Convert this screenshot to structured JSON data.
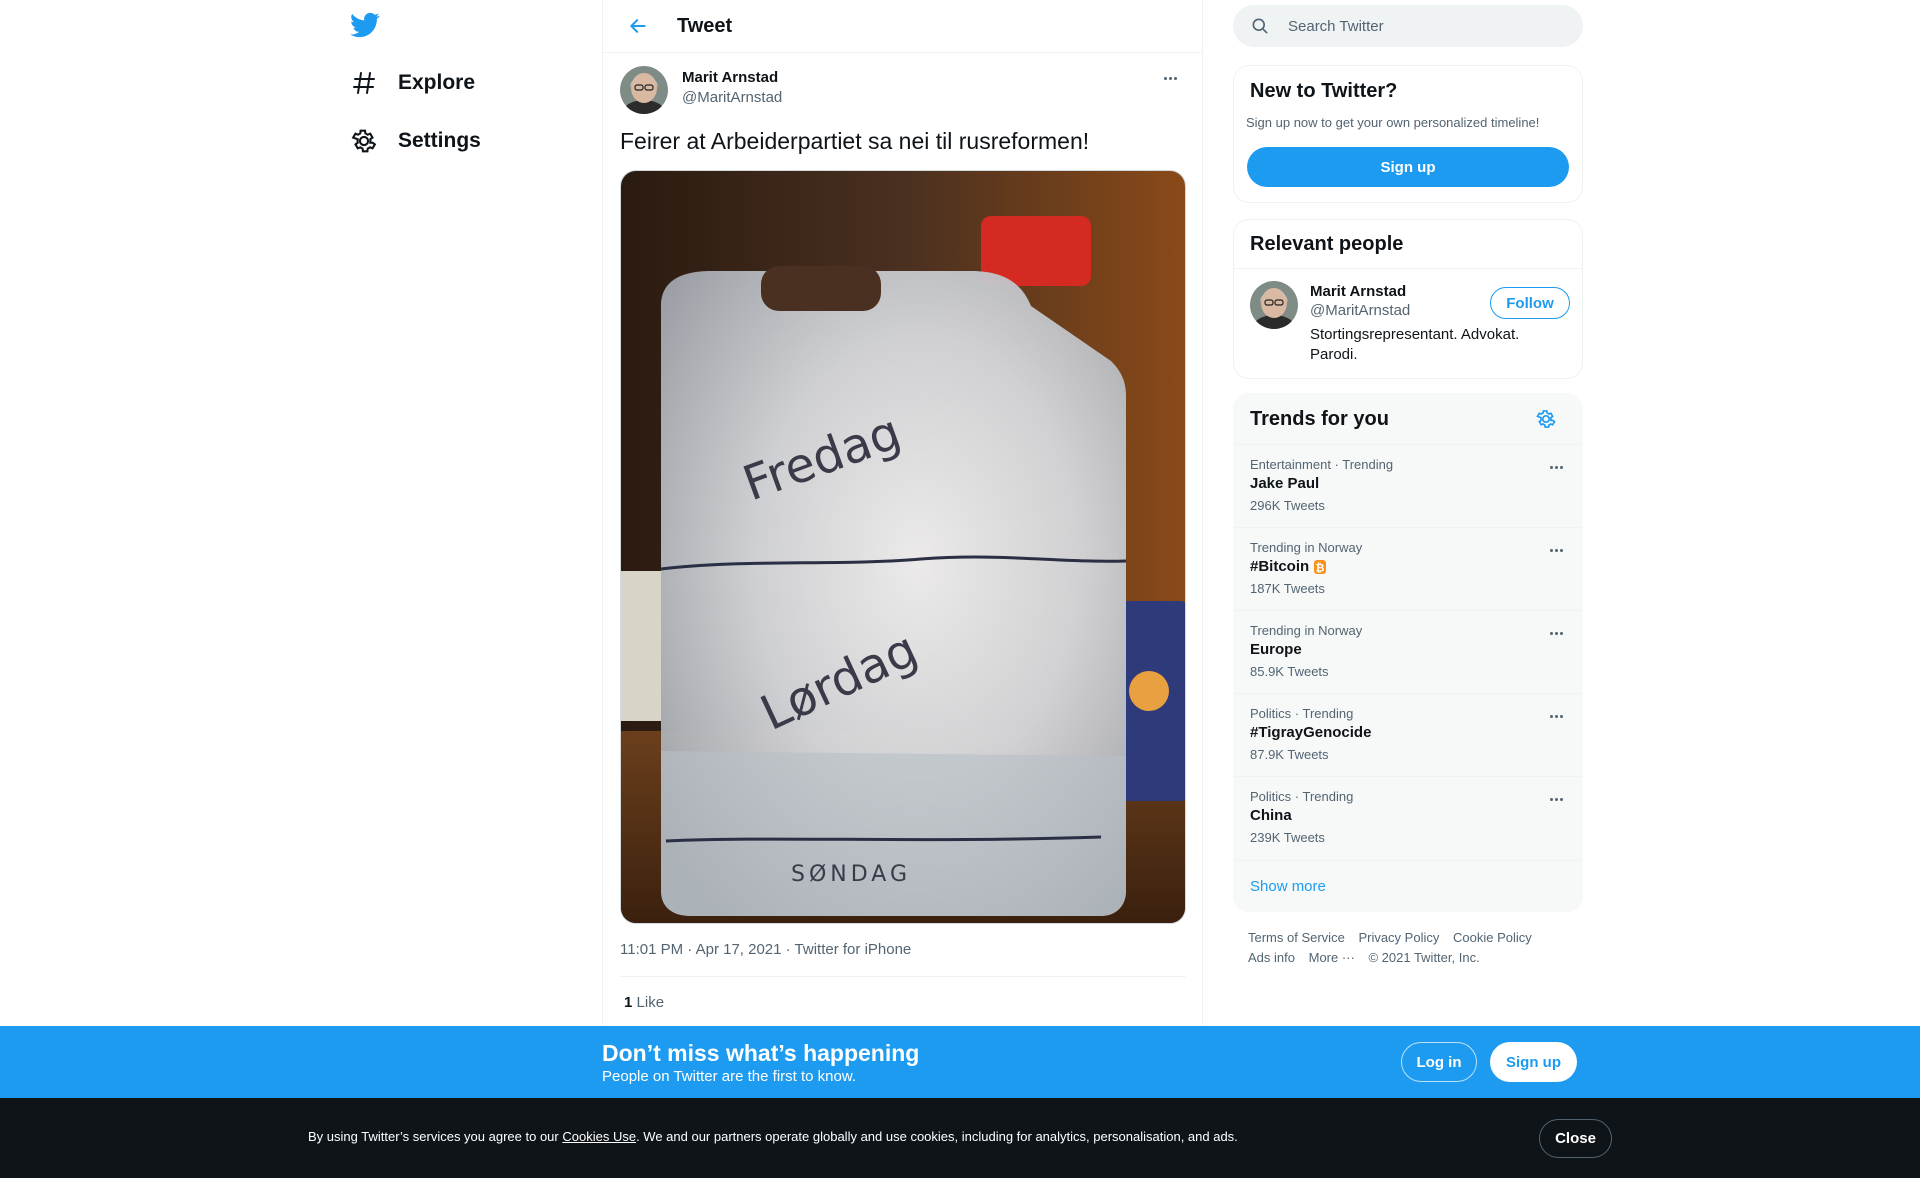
{
  "nav": {
    "logo_icon": "twitter-bird-icon",
    "items": [
      {
        "label": "Explore",
        "icon": "hashtag-icon"
      },
      {
        "label": "Settings",
        "icon": "gear-icon"
      }
    ]
  },
  "header": {
    "title": "Tweet",
    "back_icon": "arrow-left-icon"
  },
  "tweet": {
    "author_name": "Marit Arnstad",
    "author_handle": "@MaritArnstad",
    "text": "Feirer at Arbeiderpartiet sa nei til rusreformen!",
    "image_labels": [
      "Fredag",
      "Lørdag",
      "SØNDAG"
    ],
    "timestamp": "11:01 PM · Apr 17, 2021 · Twitter for iPhone",
    "likes_count": "1",
    "likes_label": "Like"
  },
  "search": {
    "placeholder": "Search Twitter"
  },
  "new_to_twitter": {
    "title": "New to Twitter?",
    "subtitle": "Sign up now to get your own personalized timeline!",
    "signup_label": "Sign up"
  },
  "relevant_people": {
    "title": "Relevant people",
    "person": {
      "name": "Marit Arnstad",
      "handle": "@MaritArnstad",
      "bio": "Stortingsrepresentant. Advokat. Parodi.",
      "follow_label": "Follow"
    }
  },
  "trends": {
    "title": "Trends for you",
    "items": [
      {
        "meta": "Entertainment · Trending",
        "name": "Jake Paul",
        "count": "296K Tweets"
      },
      {
        "meta": "Trending in Norway",
        "name": "#Bitcoin",
        "count": "187K Tweets"
      },
      {
        "meta": "Trending in Norway",
        "name": "Europe",
        "count": "85.9K Tweets"
      },
      {
        "meta": "Politics · Trending",
        "name": "#TigrayGenocide",
        "count": "87.9K Tweets"
      },
      {
        "meta": "Politics · Trending",
        "name": "China",
        "count": "239K Tweets"
      }
    ],
    "show_more": "Show more"
  },
  "footer": {
    "links": [
      "Terms of Service",
      "Privacy Policy",
      "Cookie Policy",
      "Ads info",
      "More ···"
    ],
    "copyright": "© 2021 Twitter, Inc."
  },
  "bottom_bar": {
    "title": "Don’t miss what’s happening",
    "subtitle": "People on Twitter are the first to know.",
    "login_label": "Log in",
    "signup_label": "Sign up"
  },
  "cookie": {
    "text_before": "By using Twitter’s services you agree to our ",
    "link": "Cookies Use",
    "text_after": ". We and our partners operate globally and use cookies, including for analytics, personalisation, and ads.",
    "close_label": "Close"
  },
  "colors": {
    "accent": "#1d9bf0",
    "text": "#0f1419",
    "secondary": "#536471",
    "cookie_bg": "#0f1419"
  }
}
